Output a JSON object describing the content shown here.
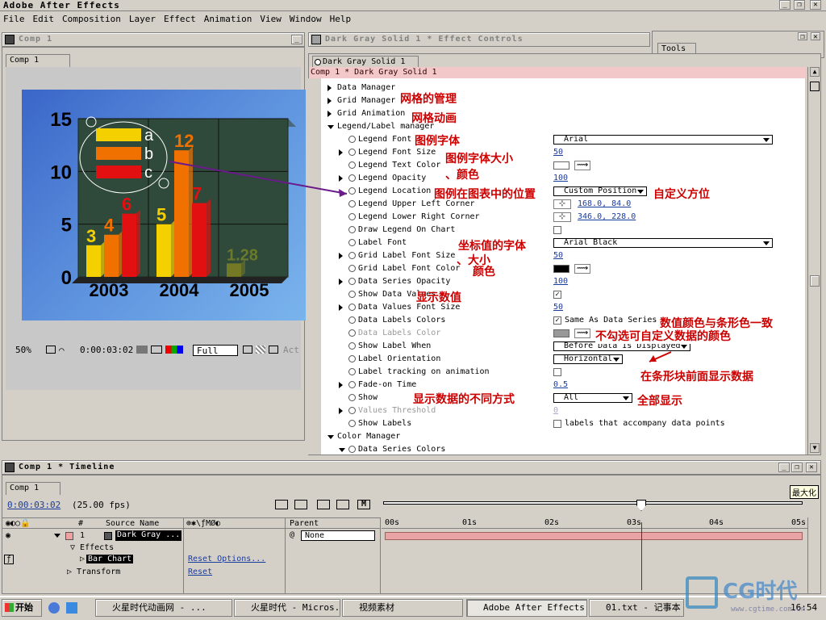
{
  "app": {
    "title": "Adobe After Effects"
  },
  "menu": [
    "File",
    "Edit",
    "Composition",
    "Layer",
    "Effect",
    "Animation",
    "View",
    "Window",
    "Help"
  ],
  "comp_panel": {
    "title": "Comp 1",
    "tab": "Comp 1",
    "zoom": "50%",
    "timecode": "0:00:03:02",
    "resolution": "Full",
    "active_label": "Act"
  },
  "chart_data": {
    "type": "bar",
    "categories": [
      "2003",
      "2004",
      "2005"
    ],
    "series": [
      {
        "name": "a",
        "values": [
          3,
          5,
          1.28
        ],
        "color": "#f5d000"
      },
      {
        "name": "b",
        "values": [
          4,
          12,
          null
        ],
        "color": "#f07000"
      },
      {
        "name": "c",
        "values": [
          6,
          7,
          null
        ],
        "color": "#e21010"
      }
    ],
    "value_labels": [
      [
        "3",
        "4",
        "6"
      ],
      [
        "5",
        "12",
        "7"
      ],
      [
        "1.28"
      ]
    ],
    "yticks": [
      "15",
      "10",
      "5",
      "0"
    ],
    "ylim": [
      0,
      15
    ],
    "legend_items": [
      "a",
      "b",
      "c"
    ]
  },
  "effect_panel": {
    "title": "Dark Gray Solid 1 * Effect Controls",
    "tab": "Dark Gray Solid 1",
    "breadcrumb": "Comp 1 * Dark Gray Solid 1"
  },
  "tools": {
    "title": "Tools"
  },
  "effect_rows": [
    {
      "label": "Data Manager"
    },
    {
      "label": "Grid Manager"
    },
    {
      "label": "Grid Animation"
    },
    {
      "label": "Legend/Label manager"
    },
    {
      "label": "Legend Font",
      "dropdown": "Arial"
    },
    {
      "label": "Legend Font Size",
      "value": "50"
    },
    {
      "label": "Legend Text Color"
    },
    {
      "label": "Legend Opacity",
      "value": "100"
    },
    {
      "label": "Legend Location",
      "dropdown": "Custom Position"
    },
    {
      "label": "Legend Upper Left Corner",
      "value": "168.0, 84.0"
    },
    {
      "label": "Legend Lower Right Corner",
      "value": "346.0, 228.0"
    },
    {
      "label": "Draw Legend On Chart"
    },
    {
      "label": "Label Font",
      "dropdown": "Arial Black"
    },
    {
      "label": "Grid Label Font Size",
      "value": "50"
    },
    {
      "label": "Grid Label Font Color"
    },
    {
      "label": "Data Series Opacity",
      "value": "100"
    },
    {
      "label": "Show Data Values"
    },
    {
      "label": "Data Values Font Size",
      "value": "50"
    },
    {
      "label": "Data Labels Colors",
      "check_text": "Same As Data Series"
    },
    {
      "label": "Data Labels Color"
    },
    {
      "label": "Show Label When",
      "dropdown": "Before Data Is Displayed"
    },
    {
      "label": "Label Orientation",
      "dropdown": "Horizontal"
    },
    {
      "label": "Label tracking on animation"
    },
    {
      "label": "Fade-on Time",
      "value": "0.5"
    },
    {
      "label": "Show",
      "dropdown": "All"
    },
    {
      "label": "Values Threshold",
      "value": "0"
    },
    {
      "label": "Show Labels",
      "check_text": "labels that accompany data points"
    },
    {
      "label": "Color Manager"
    },
    {
      "label": "Data Series Colors"
    }
  ],
  "annotations": [
    "网格的管理",
    "网格动画",
    "图例字体",
    "图例字体大小",
    "、颜色",
    "图例在图表中的位置",
    "自定义方位",
    "坐标值的字体",
    "、大小",
    "颜色",
    "显示数值",
    "数值颜色与条形色一致",
    "不勾选可自定义数据的颜色",
    "在条形块前面显示数据",
    "显示数据的不同方式",
    "全部显示"
  ],
  "timeline": {
    "title": "Comp 1 * Timeline",
    "tab": "Comp 1",
    "timecode": "0:00:03:02",
    "fps": "(25.00 fps)",
    "columns": {
      "num": "#",
      "source": "Source Name",
      "parent": "Parent"
    },
    "layer": {
      "num": "1",
      "name": "Dark Gray ...",
      "parent": "None"
    },
    "effects_label": "Effects",
    "effect_name": "Bar Chart",
    "reset_options": "Reset Options...",
    "transform": "Transform",
    "reset": "Reset",
    "ruler": [
      "00s",
      "01s",
      "02s",
      "03s",
      "04s",
      "05s"
    ],
    "maximize_tip": "最大化"
  },
  "taskbar": {
    "start": "开始",
    "items": [
      "火星时代动画网 - ...",
      "火星时代 - Micros...",
      "视频素材",
      "Adobe After Effects",
      "01.txt - 记事本"
    ],
    "clock": "16:54"
  },
  "watermark": {
    "text": "CG时代",
    "url": "www.cgtime.com.cn"
  }
}
